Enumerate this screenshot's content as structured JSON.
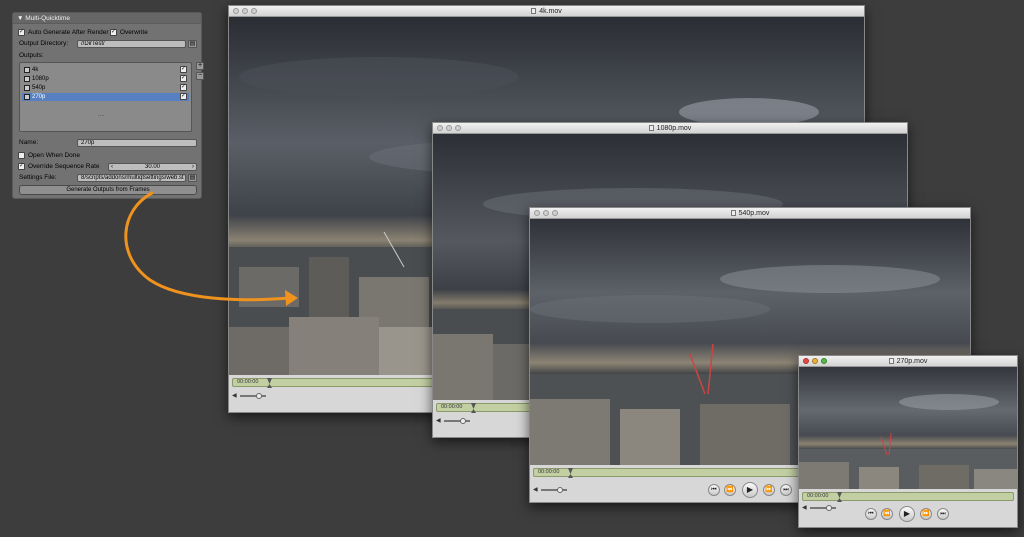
{
  "panel": {
    "header": "▼ Multi-Quicktime",
    "auto_generate_label": "Auto Generate After Render",
    "overwrite_label": "Overwrite",
    "output_directory_label": "Output Directory:",
    "output_directory_value": "//DirTest/",
    "outputs_label": "Outputs:",
    "outputs": [
      {
        "label": "4k",
        "checked": true
      },
      {
        "label": "1080p",
        "checked": true
      },
      {
        "label": "540p",
        "checked": true
      },
      {
        "label": "270p",
        "checked": true,
        "selected": true
      }
    ],
    "list_grip": "....",
    "add_button": "+",
    "remove_button": "−",
    "name_label": "Name:",
    "name_value": "270p",
    "open_when_done_label": "Open When Done",
    "override_rate_label": "Override Sequence Rate",
    "rate_value": "30.00",
    "rate_left_arrow": "‹",
    "rate_right_arrow": "›",
    "settings_file_label": "Settings File:",
    "settings_file_value": "8/scripts/addons/multiqtsettings/web.st",
    "generate_button": "Generate Outputs from Frames"
  },
  "windows": [
    {
      "title": "4k.mov",
      "timecode": "00:00:00",
      "active": false
    },
    {
      "title": "1080p.mov",
      "timecode": "00:00:00",
      "active": false
    },
    {
      "title": "540p.mov",
      "timecode": "00:00:00",
      "active": false
    },
    {
      "title": "270p.mov",
      "timecode": "00:00:00",
      "active": true
    }
  ],
  "transport": {
    "rewind_end": "⏮",
    "rewind": "⏪",
    "play": "▶",
    "forward": "⏩",
    "forward_end": "⏭"
  },
  "volume_icon": "◀",
  "colors": {
    "background": "#3d3d3d",
    "arrow": "#f0921e",
    "selection": "#5680c2",
    "scrubber": "#c2cfa3"
  }
}
